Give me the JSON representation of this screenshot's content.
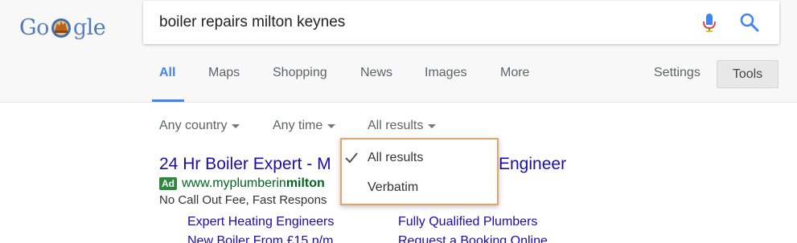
{
  "logo": {
    "g": "G",
    "o": "o",
    "g2": "g",
    "le": "le"
  },
  "search": {
    "query": "boiler repairs milton keynes"
  },
  "tabs": [
    {
      "label": "All",
      "active": true
    },
    {
      "label": "Maps"
    },
    {
      "label": "Shopping"
    },
    {
      "label": "News"
    },
    {
      "label": "Images"
    },
    {
      "label": "More"
    }
  ],
  "settings_label": "Settings",
  "tools_label": "Tools",
  "filters": {
    "country": "Any country",
    "time": "Any time",
    "results": "All results"
  },
  "dropdown": {
    "items": [
      "All results",
      "Verbatim"
    ],
    "selected": "All results"
  },
  "ad": {
    "title_start": "24 Hr Boiler Expert - M",
    "title_end": "Engineer",
    "badge": "Ad",
    "url_start": "www.myplumberin",
    "url_bold": "milton",
    "description": "No Call Out Fee, Fast Respons",
    "sitelinks": [
      "Expert Heating Engineers",
      "Fully Qualified Plumbers",
      "New Boiler From £15 p/m",
      "Request a Booking Online"
    ]
  },
  "colors": {
    "accent": "#4285f4",
    "link": "#1a0dab",
    "url_green": "#006621",
    "highlight_border": "#e0a56a"
  }
}
